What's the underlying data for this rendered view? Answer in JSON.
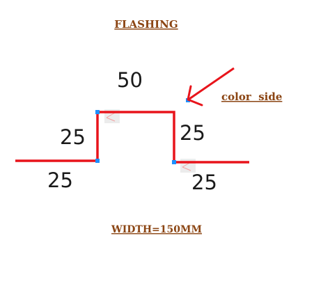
{
  "title": "FLASHING",
  "arrow_label": "color  side",
  "width_label": "WIDTH=150MM",
  "dimensions": {
    "top": "50",
    "left_flange": "25",
    "left_rise": "25",
    "right_drop": "25",
    "right_flange": "25"
  },
  "colors": {
    "profile_line": "#e8141b",
    "label_text": "#8B4513",
    "dimension_text": "#1a1a1a",
    "node_marker": "#1e90ff",
    "angle_marker": "#e8e8e8"
  },
  "icons": {
    "pointer": "arrow-icon"
  }
}
